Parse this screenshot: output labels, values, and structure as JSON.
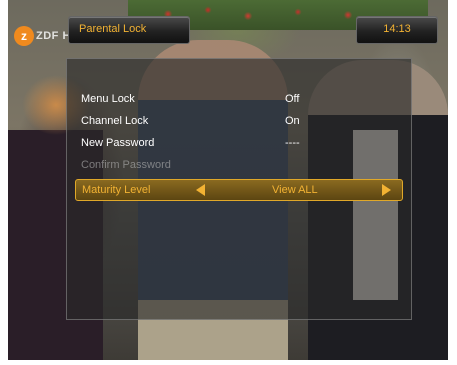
{
  "channel": {
    "logo_letter": "z",
    "logo_text": "ZDF HD"
  },
  "header": {
    "title": "Parental Lock",
    "clock": "14:13"
  },
  "menu": {
    "rows": [
      {
        "label": "Menu Lock",
        "value": "Off"
      },
      {
        "label": "Channel Lock",
        "value": "On"
      },
      {
        "label": "New Password",
        "value": "----"
      },
      {
        "label": "Confirm Password",
        "value": ""
      },
      {
        "label": "Maturity Level",
        "value": "View ALL"
      }
    ],
    "selected_index": 4
  },
  "colors": {
    "accent": "#f2b233",
    "panel": "#282828",
    "highlight": "#8a6a20"
  },
  "icons": {
    "left": "triangle-left-icon",
    "right": "triangle-right-icon"
  }
}
